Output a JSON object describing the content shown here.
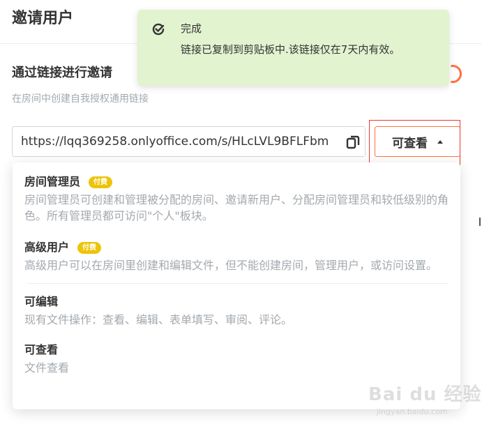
{
  "panel": {
    "title": "邀请用户"
  },
  "link_section": {
    "title": "通过链接进行邀请",
    "description": "在房间中创建自我授权通用链接",
    "link_value": "https://lqq369258.onlyoffice.com/s/HLcLVL9BFLFbm",
    "access_button_label": "可查看"
  },
  "toast": {
    "title": "完成",
    "message": "链接已复制到剪贴板中.该链接仅在7天内有效。",
    "icon": "check-circle-icon"
  },
  "access_menu": {
    "items": [
      {
        "title": "房间管理员",
        "badge": "付费",
        "description": "房间管理员可创建和管理被分配的房间、邀请新用户、分配房间管理员和较低级别的角色。所有管理员都可访问\"个人\"板块。"
      },
      {
        "title": "高级用户",
        "badge": "付费",
        "description": "高级用户可以在房间里创建和编辑文件，但不能创建房间，管理用户，或访问设置。"
      },
      {
        "title": "可编辑",
        "description": "现有文件操作：查看、编辑、表单填写、审阅、评论。"
      },
      {
        "title": "可查看",
        "description": "文件查看"
      }
    ]
  },
  "watermark": {
    "text": "Bai du 经验",
    "subtext": "jingyan.baidu.com"
  },
  "colors": {
    "accent": "#ff6f3d",
    "badge": "#edc409",
    "toast_bg": "#e2f3cf",
    "muted_text": "#a3a9ae"
  }
}
